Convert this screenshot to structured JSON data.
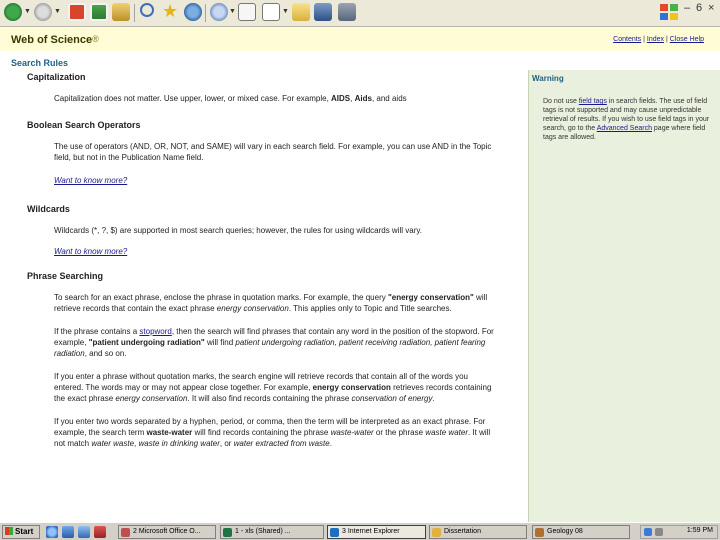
{
  "toolbar": {
    "icons": [
      "back-icon",
      "forward-icon",
      "stop-icon",
      "refresh-icon",
      "home-icon",
      "search-icon",
      "favorites-icon",
      "history-icon",
      "mail-icon",
      "print-icon",
      "edit-icon",
      "folder-icon",
      "messenger-icon",
      "research-icon"
    ],
    "window_controls": [
      "–",
      "6",
      "×"
    ]
  },
  "header": {
    "brand": "Web of Science",
    "brand_mark": "®",
    "links": [
      "Contents",
      "Index",
      "Close Help"
    ],
    "link_separator": " | "
  },
  "section_title": "Search Rules",
  "content": {
    "capitalization": {
      "heading": "Capitalization",
      "text_prefix": "Capitalization does not matter. Use upper, lower, or mixed case. For example, ",
      "ex1": "AIDS",
      "sep1": ", ",
      "ex2": "Aids",
      "sep2": ", and ",
      "ex3": "aids"
    },
    "boolean": {
      "heading": "Boolean Search Operators",
      "text": "The use of operators (AND, OR, NOT, and SAME) will vary in each search field. For example, you can use AND in the Topic field, but not in the Publication Name field.",
      "more": "Want to know more?"
    },
    "wildcards": {
      "heading": "Wildcards",
      "text": "Wildcards (*, ?, $) are supported in most search queries; however, the rules for using wildcards will vary.",
      "more": "Want to know more?"
    },
    "phrase": {
      "heading": "Phrase Searching",
      "p1_a": "To search for an exact phrase, enclose the phrase in quotation marks. For example, the query ",
      "p1_b": "\"energy conservation\"",
      "p1_c": " will retrieve records that contain the exact phrase ",
      "p1_d": "energy conservation",
      "p1_e": ". This applies only to Topic and Title searches.",
      "p2_a": "If the phrase contains a ",
      "p2_b": "stopword",
      "p2_c": ", then the search will find phrases that contain any word in the position of the stopword. For example, ",
      "p2_d": "\"patient undergoing radiation\"",
      "p2_e": " will find ",
      "p2_f": "patient undergoing radiation, patient receiving radiation, patient fearing radiation",
      "p2_g": ", and so on.",
      "p3_a": "If you enter a phrase without quotation marks, the search engine will retrieve records that contain all of the words you entered. The words may or may not appear close together. For example, ",
      "p3_b": "energy conservation",
      "p3_c": " retrieves records containing the exact phrase ",
      "p3_d": "energy conservation",
      "p3_e": ". It will also find records containing the phrase ",
      "p3_f": "conservation of energy",
      "p3_g": ".",
      "p4_a": "If you enter two words separated by a hyphen, period, or comma, then the term will be interpreted as an exact phrase. For example, the search term ",
      "p4_b": "waste-water",
      "p4_c": " will find records containing the phrase ",
      "p4_d": "waste-water",
      "p4_e": " or the phrase ",
      "p4_f": "waste water",
      "p4_g": ". It will not match ",
      "p4_h": "water waste",
      "p4_i": ", ",
      "p4_j": "waste in drinking water",
      "p4_k": ", or ",
      "p4_l": "water extracted from waste",
      "p4_m": "."
    }
  },
  "sidebar": {
    "title": "Warning",
    "t1": "Do not use ",
    "l1": "field tags",
    "t2": " in search fields. The use of field tags is not supported and may cause unpredictable retrieval of results. If you wish to use field tags in your search, go to the ",
    "l2": "Advanced Search",
    "t3": " page where field tags are allowed."
  },
  "taskbar": {
    "start": "Start",
    "tasks": [
      {
        "label": "2 Microsoft Office O...",
        "icon_color": "#c0504d"
      },
      {
        "label": "1 - xls (Shared) ...",
        "icon_color": "#217346"
      },
      {
        "label": "3 Internet Explorer",
        "icon_color": "#1f6fbf"
      },
      {
        "label": "Dissertation",
        "icon_color": "#e0b040"
      },
      {
        "label": "Geology 08",
        "icon_color": "#b07030"
      }
    ],
    "clock": "1:59 PM"
  },
  "colors": {
    "header_bg": "#fffdd6",
    "sidebar_bg": "#e9f0de",
    "accent": "#1f5f86",
    "link": "#1a1a8f"
  }
}
